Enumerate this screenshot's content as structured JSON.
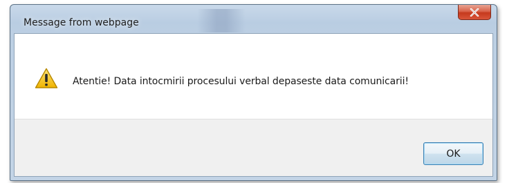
{
  "dialog": {
    "title": "Message from webpage",
    "close_icon": "close-icon",
    "warning_icon": "warning-icon",
    "message": "Atentie! Data intocmirii procesului verbal depaseste data comunicarii!",
    "ok_label": "OK"
  },
  "colors": {
    "close_button": "#d9634a",
    "warning_yellow": "#f5c518",
    "ok_border": "#3c7fb1"
  }
}
